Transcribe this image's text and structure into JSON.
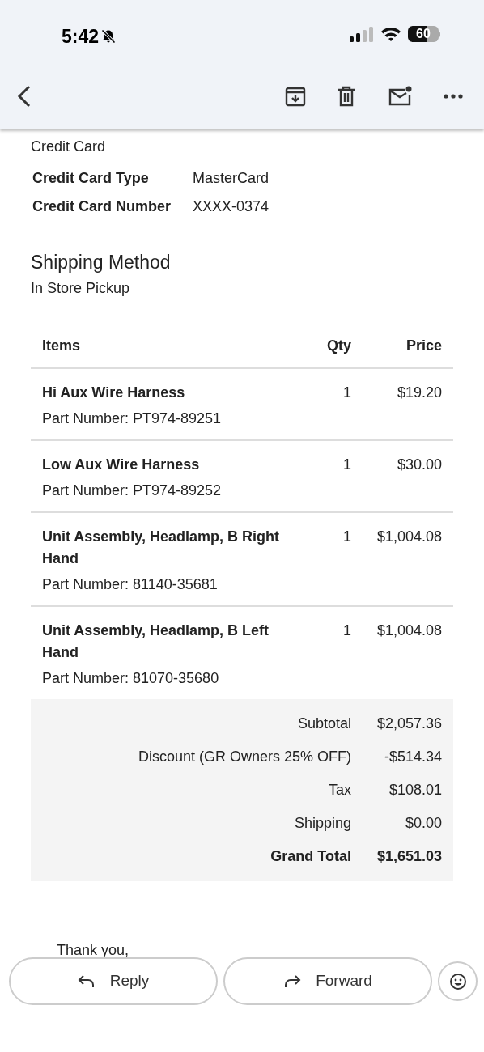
{
  "status_bar": {
    "time": "5:42",
    "battery": "60"
  },
  "payment": {
    "value": "Credit Card",
    "fields": [
      {
        "label": "Credit Card Type",
        "value": "MasterCard"
      },
      {
        "label": "Credit Card Number",
        "value": "XXXX-0374"
      }
    ]
  },
  "shipping": {
    "heading": "Shipping Method",
    "value": "In Store Pickup"
  },
  "table": {
    "columns": [
      "Items",
      "Qty",
      "Price"
    ],
    "rows": [
      {
        "name": "Hi Aux Wire Harness",
        "part": "Part Number: PT974-89251",
        "qty": "1",
        "price": "$19.20"
      },
      {
        "name": "Low Aux Wire Harness",
        "part": "Part Number: PT974-89252",
        "qty": "1",
        "price": "$30.00"
      },
      {
        "name": "Unit Assembly, Headlamp, B Right Hand",
        "part": "Part Number: 81140-35681",
        "qty": "1",
        "price": "$1,004.08"
      },
      {
        "name": "Unit Assembly, Headlamp, B Left Hand",
        "part": "Part Number: 81070-35680",
        "qty": "1",
        "price": "$1,004.08"
      }
    ]
  },
  "totals": [
    {
      "label": "Subtotal",
      "value": "$2,057.36",
      "bold": false
    },
    {
      "label": "Discount (GR Owners 25% OFF)",
      "value": "-$514.34",
      "bold": false
    },
    {
      "label": "Tax",
      "value": "$108.01",
      "bold": false
    },
    {
      "label": "Shipping",
      "value": "$0.00",
      "bold": false
    },
    {
      "label": "Grand Total",
      "value": "$1,651.03",
      "bold": true
    }
  ],
  "closing": "Thank you,",
  "actions": {
    "reply": "Reply",
    "forward": "Forward"
  }
}
